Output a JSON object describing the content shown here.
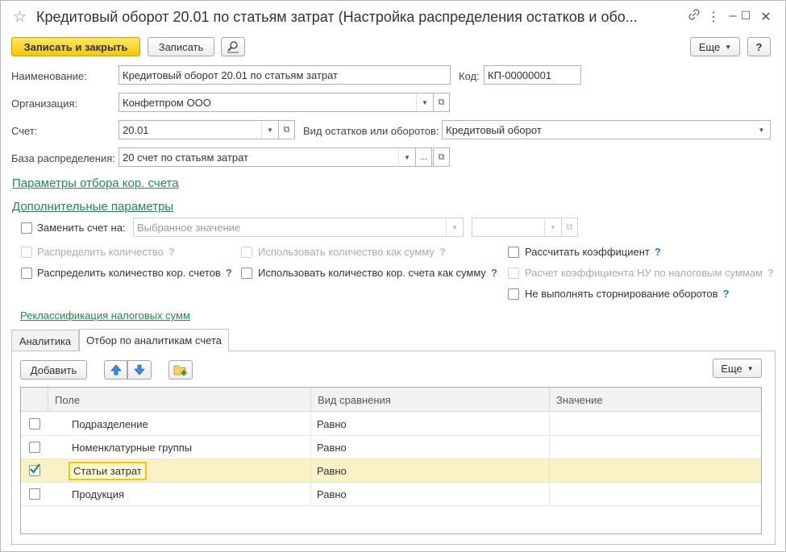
{
  "window": {
    "title": "Кредитовый оборот 20.01 по статьям затрат (Настройка распределения остатков и обо...",
    "star_glyph": "☆",
    "link_glyph": "🔗",
    "more_glyph": "⋮",
    "minimize_glyph": "–",
    "maximize_glyph": "☐",
    "close_glyph": "✕"
  },
  "toolbar": {
    "save_close_label": "Записать и закрыть",
    "save_label": "Записать",
    "find_icon": "search-doc-icon",
    "more_label": "Еще",
    "help_label": "?"
  },
  "form": {
    "name_label": "Наименование:",
    "name_value": "Кредитовый оборот 20.01 по статьям затрат",
    "code_label": "Код:",
    "code_value": "КП-00000001",
    "org_label": "Организация:",
    "org_value": "Конфетпром ООО",
    "account_label": "Счет:",
    "account_value": "20.01",
    "kind_label": "Вид остатков или оборотов:",
    "kind_value": "Кредитовый оборот",
    "base_label": "База распределения:",
    "base_value": "20 счет по статьям затрат",
    "ellipsis": "..."
  },
  "links": {
    "corr_filter": "Параметры отбора кор. счета",
    "additional": "Дополнительные параметры",
    "reclass": "Реклассификация налоговых сумм"
  },
  "options": {
    "replace_account_label": "Заменить счет на:",
    "replace_account_placeholder": "Выбранное значение",
    "distribute_qty": "Распределить количество",
    "use_qty_as_sum": "Использовать количество как сумму",
    "calc_coef": "Рассчитать коэффициент",
    "distribute_qty_corr": "Распределить количество кор. счетов",
    "use_qty_corr_as_sum": "Использовать количество кор. счета как сумму",
    "calc_coef_nu": "Расчет коэффициента НУ по налоговым суммам",
    "no_storno": "Не выполнять сторнирование оборотов",
    "help_mark": "?"
  },
  "tabs": [
    {
      "label": "Аналитика"
    },
    {
      "label": "Отбор по аналитикам счета"
    }
  ],
  "grid_toolbar": {
    "add_label": "Добавить",
    "more_label": "Еще"
  },
  "grid": {
    "headers": [
      "Поле",
      "Вид сравнения",
      "Значение"
    ],
    "rows": [
      {
        "field": "Подразделение",
        "compare": "Равно",
        "value": "",
        "checked": false
      },
      {
        "field": "Номенклатурные группы",
        "compare": "Равно",
        "value": "",
        "checked": false
      },
      {
        "field": "Статьи затрат",
        "compare": "Равно",
        "value": "",
        "checked": true
      },
      {
        "field": "Продукция",
        "compare": "Равно",
        "value": "",
        "checked": false
      }
    ]
  },
  "colors": {
    "primary": "#f3c800",
    "link": "#1f8c4c",
    "help": "#2d79c8",
    "selected_row": "#fbf1c7"
  }
}
